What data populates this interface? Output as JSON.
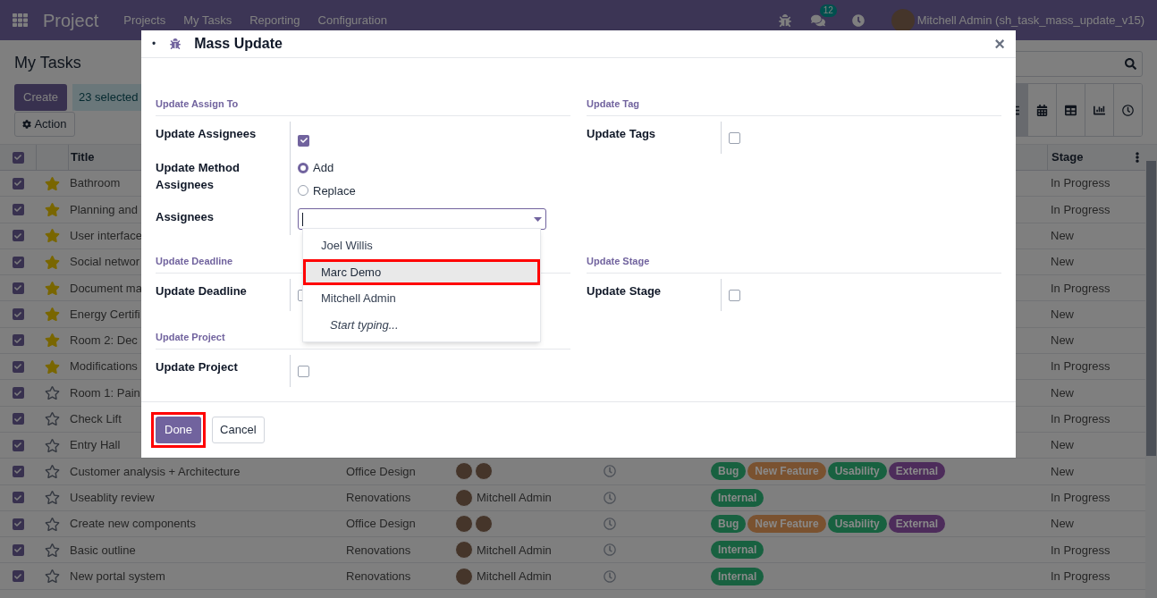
{
  "navbar": {
    "app": "Project",
    "menu": [
      "Projects",
      "My Tasks",
      "Reporting",
      "Configuration"
    ],
    "messages_badge": "12",
    "user": "Mitchell Admin (sh_task_mass_update_v15)"
  },
  "control_panel": {
    "title": "My Tasks",
    "create": "Create",
    "selection": "23 selected",
    "action": "Action",
    "views": [
      {
        "kind": "list",
        "selected": true
      },
      {
        "kind": "calendar",
        "selected": false
      },
      {
        "kind": "pivot",
        "selected": false
      },
      {
        "kind": "graph",
        "selected": false
      },
      {
        "kind": "activity",
        "selected": false
      }
    ]
  },
  "list": {
    "all_checked": true,
    "columns": {
      "title": "Title",
      "stage": "Stage"
    },
    "rows": [
      {
        "checked": true,
        "starred": true,
        "title": "Bathroom",
        "stage": "In Progress"
      },
      {
        "checked": true,
        "starred": true,
        "title": "Planning and",
        "stage": "In Progress"
      },
      {
        "checked": true,
        "starred": true,
        "title": "User interface",
        "stage": "New"
      },
      {
        "checked": true,
        "starred": true,
        "title": "Social networ",
        "stage": "New"
      },
      {
        "checked": true,
        "starred": true,
        "title": "Document ma",
        "stage": "In Progress"
      },
      {
        "checked": true,
        "starred": true,
        "title": "Energy Certifi",
        "stage": "New"
      },
      {
        "checked": true,
        "starred": true,
        "title": "Room 2: Dec",
        "stage": "New"
      },
      {
        "checked": true,
        "starred": true,
        "title": "Modifications",
        "stage": "In Progress"
      },
      {
        "checked": true,
        "starred": false,
        "title": "Room 1: Pain",
        "stage": "New"
      },
      {
        "checked": true,
        "starred": false,
        "title": "Check Lift",
        "stage": "In Progress"
      },
      {
        "checked": true,
        "starred": false,
        "title": "Entry Hall",
        "stage": "New"
      },
      {
        "checked": true,
        "starred": false,
        "title": "Customer analysis + Architecture",
        "project": "Office Design",
        "assignees": [
          {
            "kind": "avatar"
          },
          {
            "kind": "avatar"
          }
        ],
        "tags": [
          {
            "label": "Bug",
            "color": "#186140"
          },
          {
            "label": "New Feature",
            "color": "#7a5230"
          },
          {
            "label": "Usability",
            "color": "#186140"
          },
          {
            "label": "External",
            "color": "#4d2c5b"
          }
        ],
        "stage": "New"
      },
      {
        "checked": true,
        "starred": false,
        "title": "Useablity review",
        "project": "Renovations",
        "assignees": [
          {
            "kind": "avatar",
            "name": "Mitchell Admin"
          }
        ],
        "tags": [
          {
            "label": "Internal",
            "color": "#186140"
          }
        ],
        "stage": "In Progress"
      },
      {
        "checked": true,
        "starred": false,
        "title": "Create new components",
        "project": "Office Design",
        "assignees": [
          {
            "kind": "avatar"
          },
          {
            "kind": "avatar"
          }
        ],
        "tags": [
          {
            "label": "Bug",
            "color": "#186140"
          },
          {
            "label": "New Feature",
            "color": "#7a5230"
          },
          {
            "label": "Usability",
            "color": "#186140"
          },
          {
            "label": "External",
            "color": "#4d2c5b"
          }
        ],
        "stage": "New"
      },
      {
        "checked": true,
        "starred": false,
        "title": "Basic outline",
        "project": "Renovations",
        "assignees": [
          {
            "kind": "avatar",
            "name": "Mitchell Admin"
          }
        ],
        "tags": [
          {
            "label": "Internal",
            "color": "#186140"
          }
        ],
        "stage": "In Progress"
      },
      {
        "checked": true,
        "starred": false,
        "title": "New portal system",
        "project": "Renovations",
        "assignees": [
          {
            "kind": "avatar",
            "name": "Mitchell Admin"
          }
        ],
        "tags": [
          {
            "label": "Internal",
            "color": "#186140"
          }
        ],
        "stage": "In Progress"
      }
    ]
  },
  "dialog": {
    "bullet": "•",
    "title": "Mass Update",
    "close": "×",
    "sections": [
      {
        "title": "Update Assign To",
        "fields": [
          {
            "kind": "checkbox",
            "label": "Update Assignees",
            "checked": true
          },
          {
            "kind": "radio",
            "label": "Update Method Assignees",
            "options": [
              {
                "label": "Add",
                "selected": true
              },
              {
                "label": "Replace",
                "selected": false
              }
            ]
          },
          {
            "kind": "many2many",
            "label": "Assignees",
            "dropdown": [
              {
                "kind": "option",
                "label": "Joel Willis",
                "highlighted": false
              },
              {
                "kind": "option",
                "label": "Marc Demo",
                "highlighted": true
              },
              {
                "kind": "option",
                "label": "Mitchell Admin",
                "highlighted": false
              },
              {
                "kind": "hint",
                "label": "Start typing...",
                "highlighted": false
              }
            ]
          }
        ]
      },
      {
        "title": "Update Tag",
        "fields": [
          {
            "kind": "checkbox",
            "label": "Update Tags",
            "checked": false
          }
        ]
      },
      {
        "title": "Update Deadline",
        "fields": [
          {
            "kind": "checkbox",
            "label": "Update Deadline",
            "checked": false
          }
        ]
      },
      {
        "title": "Update Stage",
        "fields": [
          {
            "kind": "checkbox",
            "label": "Update Stage",
            "checked": false
          }
        ]
      },
      {
        "title": "Update Project",
        "fields": [
          {
            "kind": "checkbox",
            "label": "Update Project",
            "checked": false
          }
        ]
      }
    ],
    "buttons": [
      {
        "kind": "primary",
        "label": "Done",
        "highlighted": true
      },
      {
        "kind": "secondary",
        "label": "Cancel",
        "highlighted": false
      }
    ]
  }
}
